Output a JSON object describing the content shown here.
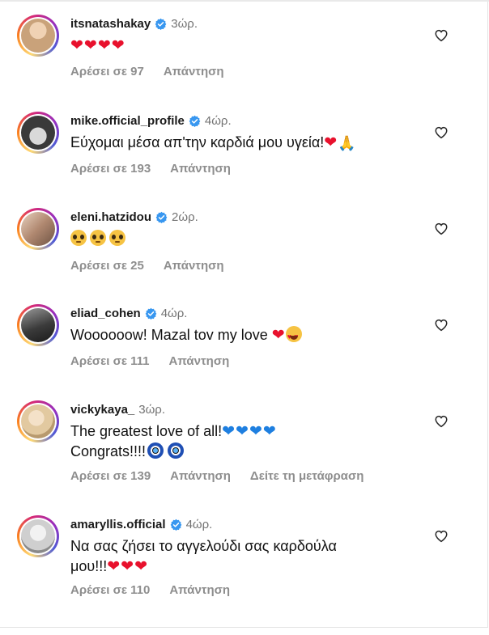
{
  "comments": [
    {
      "username": "itsnatashakay",
      "time": "3ώρ.",
      "text": "",
      "likes": "Αρέσει σε 97",
      "reply": "Απάντηση",
      "avatar_color": "#c9a27a"
    },
    {
      "username": "mike.official_profile",
      "time": "4ώρ.",
      "text": "Εύχομαι μέσα απ'την καρδιά μου υγεία!",
      "likes": "Αρέσει σε 193",
      "reply": "Απάντηση",
      "avatar_color": "#7a7a7a"
    },
    {
      "username": "eleni.hatzidou",
      "time": "2ώρ.",
      "text": "",
      "likes": "Αρέσει σε 25",
      "reply": "Απάντηση",
      "avatar_color": "#b08870"
    },
    {
      "username": "eliad_cohen",
      "time": "4ώρ.",
      "text": "Woooooow! Mazal tov my love",
      "likes": "Αρέσει σε 111",
      "reply": "Απάντηση",
      "avatar_color": "#3b3b3b"
    },
    {
      "username": "vickykaya_",
      "time": "3ώρ.",
      "text": "The greatest love of all!",
      "text2": "Congrats!!!!",
      "likes": "Αρέσει σε 139",
      "reply": "Απάντηση",
      "translate": "Δείτε τη μετάφραση",
      "avatar_color": "#e2c9a0"
    },
    {
      "username": "amaryllis.official",
      "time": "4ώρ.",
      "text": "Να σας ζήσει το αγγελούδι σας καρδούλα",
      "text2": "μου!!!",
      "likes": "Αρέσει σε 110",
      "reply": "Απάντηση",
      "avatar_color": "#cfcfcf"
    }
  ],
  "icons": {
    "verified": "verified-badge-icon",
    "like": "heart-outline-icon",
    "heart": "red-heart-emoji",
    "blue_heart": "blue-heart-emoji",
    "pleading": "pleading-face-emoji",
    "heart_eyes": "heart-eyes-emoji",
    "evil_eye": "nazar-amulet-emoji",
    "praying": "folded-hands-emoji"
  },
  "colors": {
    "verified_blue": "#3897f0",
    "meta_gray": "#8e8e8e",
    "heart_red": "#e8112d",
    "heart_blue": "#1e7fe0"
  }
}
